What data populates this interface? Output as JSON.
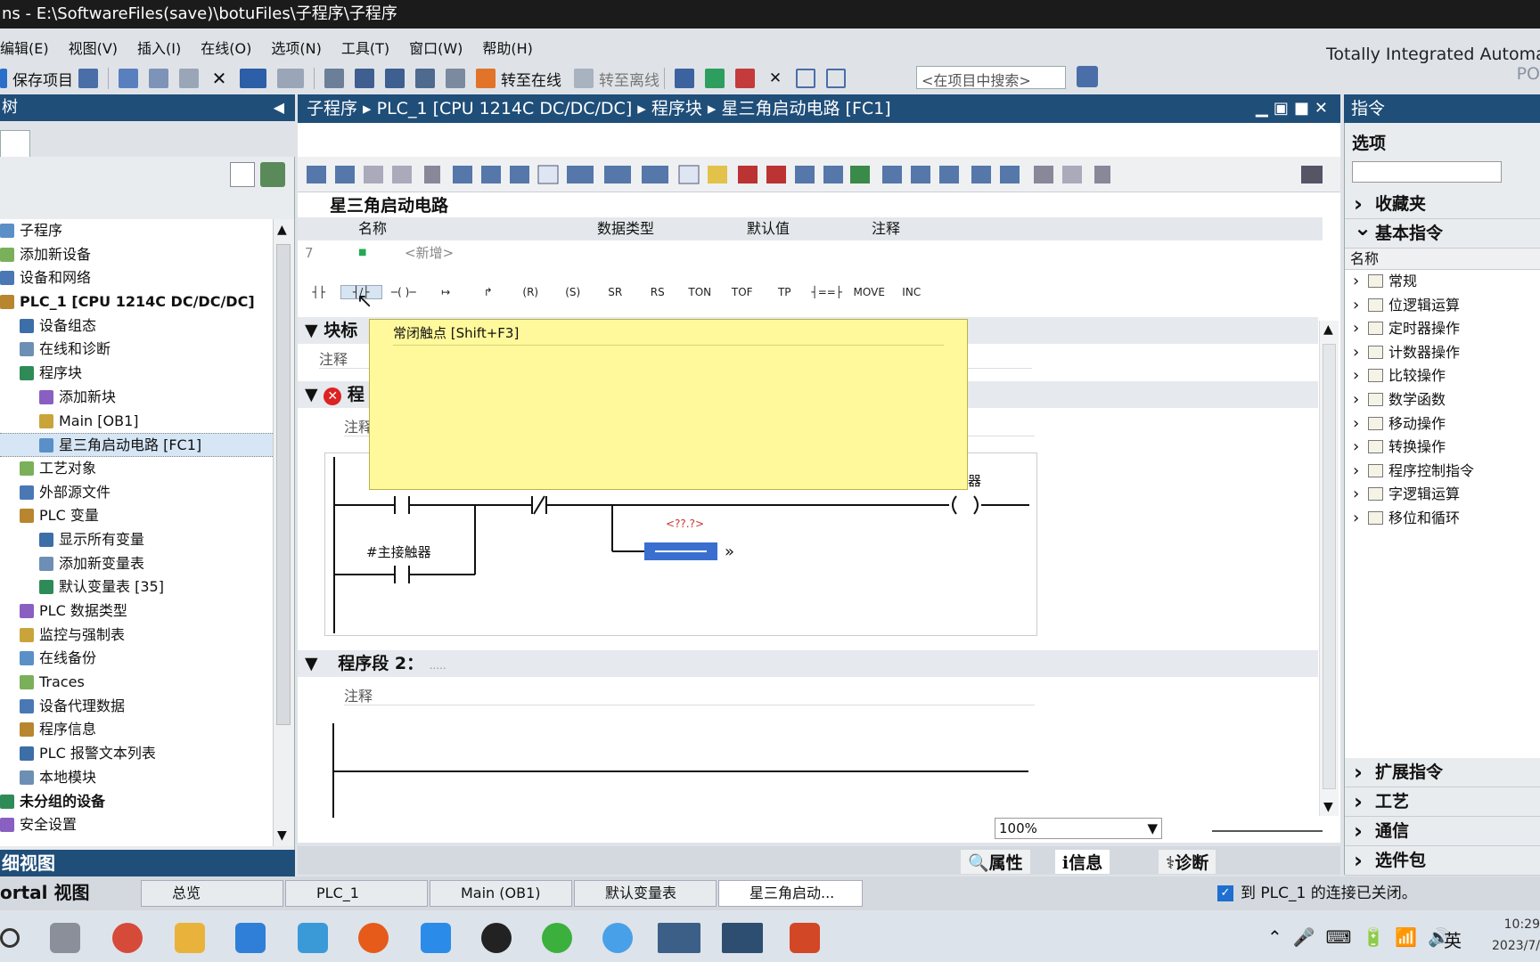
{
  "window": {
    "title": "ns  -  E:\\SoftwareFiles(save)\\botuFiles\\子程序\\子程序"
  },
  "menu": [
    "编辑(E)",
    "视图(V)",
    "插入(I)",
    "在线(O)",
    "选项(N)",
    "工具(T)",
    "窗口(W)",
    "帮助(H)"
  ],
  "brand": {
    "line1": "Totally Integrated Automat",
    "line2": "PO"
  },
  "toolbar": {
    "save": "保存项目",
    "go_online": "转至在线",
    "go_offline": "转至离线",
    "search_placeholder": "<在项目中搜索>"
  },
  "left": {
    "header": "树",
    "tab": "",
    "tree": [
      {
        "label": "子程序",
        "indent": 0
      },
      {
        "label": "添加新设备",
        "indent": 0
      },
      {
        "label": "设备和网络",
        "indent": 0
      },
      {
        "label": "PLC_1 [CPU 1214C DC/DC/DC]",
        "indent": 0,
        "bold": true
      },
      {
        "label": "设备组态",
        "indent": 1
      },
      {
        "label": "在线和诊断",
        "indent": 1
      },
      {
        "label": "程序块",
        "indent": 1
      },
      {
        "label": "添加新块",
        "indent": 2
      },
      {
        "label": "Main [OB1]",
        "indent": 2
      },
      {
        "label": "星三角启动电路 [FC1]",
        "indent": 2,
        "selected": true
      },
      {
        "label": "工艺对象",
        "indent": 1
      },
      {
        "label": "外部源文件",
        "indent": 1
      },
      {
        "label": "PLC 变量",
        "indent": 1
      },
      {
        "label": "显示所有变量",
        "indent": 2
      },
      {
        "label": "添加新变量表",
        "indent": 2
      },
      {
        "label": "默认变量表 [35]",
        "indent": 2
      },
      {
        "label": "PLC 数据类型",
        "indent": 1
      },
      {
        "label": "监控与强制表",
        "indent": 1
      },
      {
        "label": "在线备份",
        "indent": 1
      },
      {
        "label": "Traces",
        "indent": 1
      },
      {
        "label": "设备代理数据",
        "indent": 1
      },
      {
        "label": "程序信息",
        "indent": 1
      },
      {
        "label": "PLC 报警文本列表",
        "indent": 1
      },
      {
        "label": "本地模块",
        "indent": 1
      },
      {
        "label": "未分组的设备",
        "indent": 0,
        "bold": true
      },
      {
        "label": "安全设置",
        "indent": 0
      }
    ],
    "detail_view": "细视图"
  },
  "editor": {
    "breadcrumb": [
      "子程序",
      "PLC_1 [CPU 1214C DC/DC/DC]",
      "程序块",
      "星三角启动电路 [FC1]"
    ],
    "block_name": "星三角启动电路",
    "interface_cols": [
      "名称",
      "数据类型",
      "默认值",
      "注释"
    ],
    "interface_row": {
      "num": "7",
      "name": "<新增>"
    },
    "instructions": [
      "SR",
      "RS",
      "TON",
      "TOF",
      "TP",
      "MOVE",
      "INC"
    ],
    "block_title": "块标",
    "segment1": "程",
    "segment2": "程序段 2：",
    "segment2_dots": ".....",
    "comment": "注释",
    "tooltip": "常闭触点 [Shift+F3]",
    "contact_label": "#主接触器",
    "coil_label": "触器",
    "placeholder": "<??.?>",
    "zoom": "100%"
  },
  "bottom_tabs": {
    "properties": "属性",
    "info": "信息",
    "diag": "诊断"
  },
  "right": {
    "header": "指令",
    "options": "选项",
    "favorites": "收藏夹",
    "basic": "基本指令",
    "name_col": "名称",
    "items": [
      "常规",
      "位逻辑运算",
      "定时器操作",
      "计数器操作",
      "比较操作",
      "数学函数",
      "移动操作",
      "转换操作",
      "程序控制指令",
      "字逻辑运算",
      "移位和循环"
    ],
    "sections": [
      "扩展指令",
      "工艺",
      "通信",
      "选件包"
    ]
  },
  "portal": {
    "view": "ortal 视图",
    "tabs": [
      "总览",
      "PLC_1",
      "Main (OB1)",
      "默认变量表",
      "星三角启动..."
    ],
    "status": "到 PLC_1 的连接已关闭。"
  },
  "taskbar": {
    "time": "10:29",
    "date": "2023/7/",
    "ime": "英"
  }
}
